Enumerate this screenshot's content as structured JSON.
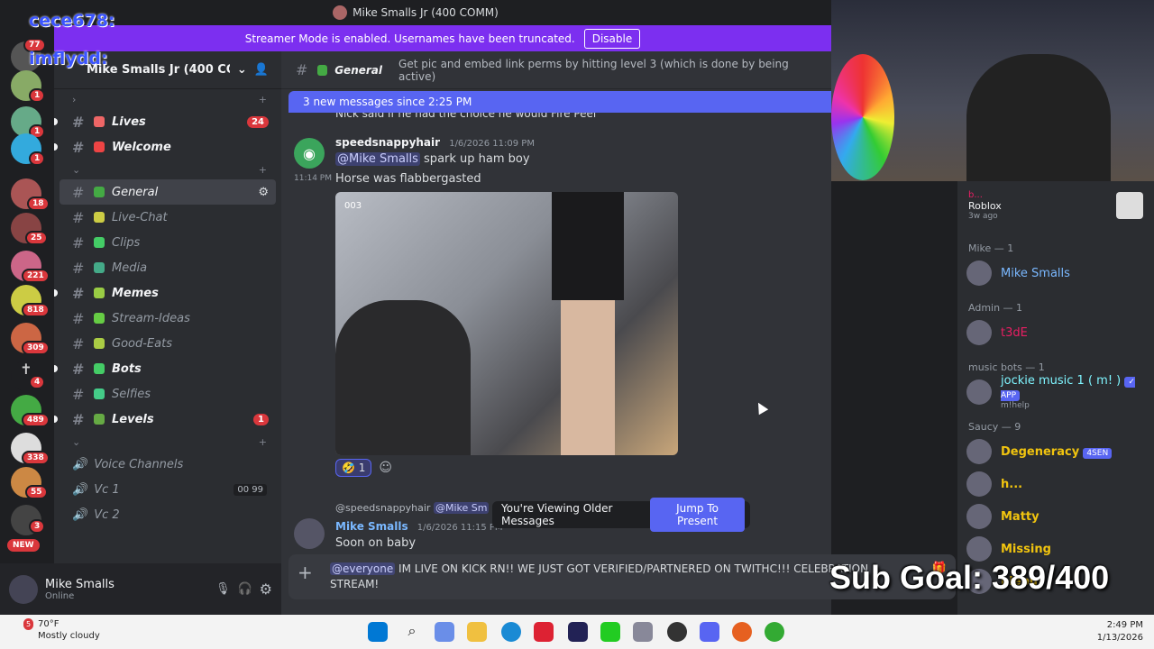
{
  "window": {
    "title": "Mike Smalls Jr (400 COMM)"
  },
  "streamer_banner": {
    "text": "Streamer Mode is enabled. Usernames have been truncated.",
    "button": "Disable"
  },
  "overlay_names": [
    "cece678:",
    "imflydd:"
  ],
  "guild_badges": [
    "77",
    "1",
    "1",
    "1",
    "18",
    "25",
    "221",
    "818",
    "309",
    "4",
    "489",
    "338",
    "55",
    "3"
  ],
  "guild_new_label": "NEW",
  "server": {
    "name": "Mike Smalls Jr (400 CO..."
  },
  "channels": [
    {
      "name": "Lives",
      "bold": true,
      "badge": "24",
      "emoji_color": "#e66"
    },
    {
      "name": "Welcome",
      "bold": true,
      "badge": "",
      "emoji_color": "#e44"
    },
    {
      "name": "General",
      "bold": false,
      "selected": true,
      "badge": "",
      "emoji_color": "#4a4"
    },
    {
      "name": "Live-Chat",
      "bold": false,
      "badge": "",
      "emoji_color": "#cc4"
    },
    {
      "name": "Clips",
      "bold": false,
      "badge": "",
      "emoji_color": "#4c6"
    },
    {
      "name": "Media",
      "bold": false,
      "badge": "",
      "emoji_color": "#4a8"
    },
    {
      "name": "Memes",
      "bold": true,
      "badge": "",
      "emoji_color": "#9c4"
    },
    {
      "name": "Stream-Ideas",
      "bold": false,
      "badge": "",
      "emoji_color": "#6c4"
    },
    {
      "name": "Good-Eats",
      "bold": false,
      "badge": "",
      "emoji_color": "#ac4"
    },
    {
      "name": "Bots",
      "bold": true,
      "badge": "",
      "emoji_color": "#4c6"
    },
    {
      "name": "Selfies",
      "bold": false,
      "badge": "",
      "emoji_color": "#4c8"
    },
    {
      "name": "Levels",
      "bold": true,
      "badge": "1",
      "emoji_color": "#6a4"
    }
  ],
  "voice": {
    "category": "Voice Channels",
    "channels": [
      "Vc 1",
      "Vc 2"
    ],
    "vc1_counts": [
      "00",
      "99"
    ]
  },
  "user": {
    "name": "Mike Smalls",
    "status": "Online"
  },
  "channel_header": {
    "name": "General",
    "topic": "Get pic and embed link perms by hitting level 3 (which is done by being active)"
  },
  "new_messages_bar": "3 new messages since 2:25 PM",
  "messages": {
    "prev_text": "Nick said if he had the choice he would Fire Peel",
    "m1": {
      "author": "speedsnappyhair",
      "time": "1/6/2026 11:09 PM",
      "mention": "@Mike Smalls",
      "text1": " spark up ham boy",
      "side_time": "11:14 PM",
      "text2": "Horse was flabbergasted",
      "image_label": "003",
      "reaction_count": "1"
    },
    "m2": {
      "reply_author": "@speedsnappyhair",
      "reply_mention": "@Mike Sm",
      "author": "Mike Smalls",
      "time": "1/6/2026 11:15 PM",
      "text": "Soon on baby"
    }
  },
  "older_bar": {
    "text": "You're Viewing Older Messages",
    "button": "Jump To Present"
  },
  "composer": {
    "mention": "@everyone",
    "text": " IM LIVE ON KICK RN!! WE JUST GOT VERIFIED/PARTNERED ON TWITHC!!! CELEBRATION STREAM!"
  },
  "members": {
    "activity": {
      "name": "b...",
      "game": "Roblox",
      "when": "3w ago"
    },
    "groups": [
      {
        "header": "Mike — 1",
        "members": [
          {
            "name": "Mike Smalls",
            "color": "#7ab8ff",
            "sub": ""
          }
        ]
      },
      {
        "header": "Admin — 1",
        "members": [
          {
            "name": "t3dE",
            "color": "#e91e63",
            "sub": ""
          }
        ]
      },
      {
        "header": "music bots — 1",
        "members": [
          {
            "name": "jockie music 1 ( m! )",
            "color": "#7ff5ff",
            "sub": "m!help",
            "tag": "✓ APP"
          }
        ]
      },
      {
        "header": "Saucy — 9",
        "members": [
          {
            "name": "Degeneracy",
            "color": "#f1c40f",
            "sub": "",
            "tag": "4SEN"
          },
          {
            "name": "h...",
            "color": "#f1c40f",
            "sub": ""
          },
          {
            "name": "Matty",
            "color": "#f1c40f",
            "sub": ""
          },
          {
            "name": "Missing",
            "color": "#f1c40f",
            "sub": ""
          },
          {
            "name": "piepur",
            "color": "#f1c40f",
            "sub": ""
          }
        ]
      }
    ]
  },
  "sub_goal": "Sub Goal: 389/400",
  "taskbar": {
    "temp": "70°F",
    "weather": "Mostly cloudy",
    "time": "2:49 PM",
    "date": "1/13/2026",
    "weather_badge": "5"
  }
}
